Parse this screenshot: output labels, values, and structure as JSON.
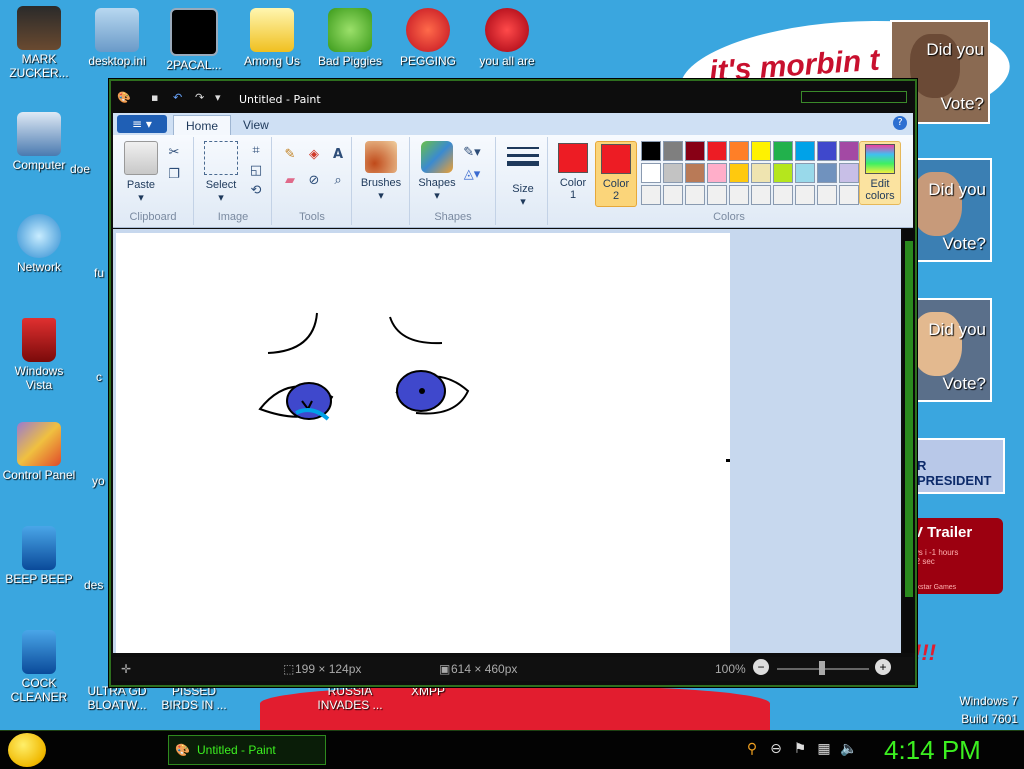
{
  "desktop": {
    "icons_left": [
      {
        "label": "MARK ZUCKER..."
      },
      {
        "label": "Computer"
      },
      {
        "label": "Network"
      },
      {
        "label": "Windows Vista"
      },
      {
        "label": "Control Panel"
      },
      {
        "label": "BEEP BEEP"
      },
      {
        "label": "COCK CLEANER"
      }
    ],
    "icons_top": [
      {
        "label": "desktop.ini"
      },
      {
        "label": "2PACAL..."
      },
      {
        "label": "Among Us"
      },
      {
        "label": "Bad Piggies"
      },
      {
        "label": "PEGGING"
      },
      {
        "label": "you all are"
      }
    ],
    "icons_bottom": [
      {
        "label": "ULTRA GD BLOATW..."
      },
      {
        "label": "PISSED BIRDS IN ..."
      },
      {
        "label": ""
      },
      {
        "label": "RUSSIA INVADES ..."
      },
      {
        "label": "XMPP"
      }
    ],
    "partial_labels": [
      "doe",
      "fu",
      "c",
      "yo",
      "des"
    ],
    "banner_text": "it's morbin t",
    "posters": [
      {
        "line1": "Did you",
        "line2": "Vote?"
      },
      {
        "line1": "Did you",
        "line2": "Vote?"
      },
      {
        "line1": "Did you",
        "line2": "Vote?"
      }
    ],
    "president_text": "R PRESIDENT",
    "trailer": {
      "title": "V Trailer",
      "lines": [
        "ws i -1 hours",
        "-2 sec"
      ],
      "footer": "ckstar Games"
    },
    "exclaim": "!!!",
    "watermark": {
      "os": "Windows 7",
      "build": "Build 7601"
    }
  },
  "paint": {
    "title": "Untitled - Paint",
    "tabs": {
      "home": "Home",
      "view": "View"
    },
    "groups": {
      "clipboard": {
        "label": "Clipboard",
        "paste": "Paste"
      },
      "image": {
        "label": "Image",
        "select": "Select"
      },
      "tools": {
        "label": "Tools"
      },
      "brushes": {
        "label": "Brushes"
      },
      "shapes": {
        "label": "Shapes",
        "shapes_btn": "Shapes"
      },
      "size": {
        "label": "Size"
      },
      "colors": {
        "label": "Colors",
        "color1": {
          "line1": "Color",
          "line2": "1",
          "value": "#ed1c24"
        },
        "color2": {
          "line1": "Color",
          "line2": "2",
          "value": "#ed1c24"
        },
        "edit": {
          "line1": "Edit",
          "line2": "colors"
        },
        "palette_row1": [
          "#000000",
          "#7f7f7f",
          "#880015",
          "#ed1c24",
          "#ff7f27",
          "#fff200",
          "#22b14c",
          "#00a2e8",
          "#3f48cc",
          "#a349a4"
        ],
        "palette_row2": [
          "#ffffff",
          "#c3c3c3",
          "#b97a57",
          "#ffaec9",
          "#ffc90e",
          "#efe4b0",
          "#b5e61d",
          "#99d9ea",
          "#7092be",
          "#c8bfe7"
        ],
        "palette_row3": [
          "#f0f0f0",
          "#f0f0f0",
          "#f0f0f0",
          "#f0f0f0",
          "#f0f0f0",
          "#f0f0f0",
          "#f0f0f0",
          "#f0f0f0",
          "#f0f0f0",
          "#f0f0f0"
        ]
      }
    },
    "status": {
      "cursor": "199 × 124px",
      "canvas_size": "614 × 460px",
      "zoom": "100%"
    },
    "colors": {
      "accent_green": "#3cf020",
      "stroke_black": "#000000",
      "eye_blue": "#3f48cc",
      "tear_blue": "#00a2e8"
    }
  },
  "taskbar": {
    "task_label": "Untitled - Paint",
    "clock": "4:14 PM",
    "tray_icons": [
      "search-icon",
      "minimize-icon",
      "flag-icon",
      "network-icon",
      "volume-icon"
    ]
  }
}
